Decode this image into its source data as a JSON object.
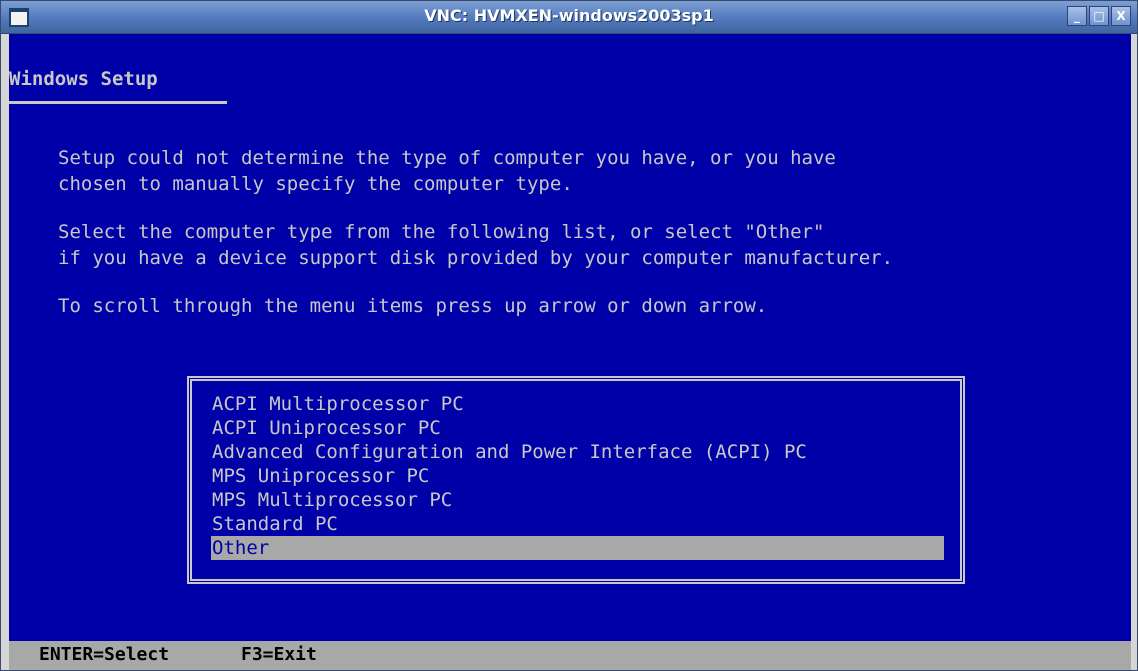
{
  "window": {
    "title": "VNC: HVMXEN-windows2003sp1",
    "buttons": [
      "_",
      "□",
      "X"
    ]
  },
  "setup": {
    "title": "Windows Setup",
    "paragraphs": [
      "Setup could not determine the type of computer you have, or you have\nchosen to manually specify the computer type.",
      "Select the computer type from the following list, or select \"Other\"\nif you have a device support disk provided by your computer manufacturer.",
      "To scroll through the menu items press up arrow or down arrow."
    ],
    "menu": {
      "items": [
        "ACPI Multiprocessor PC",
        "ACPI Uniprocessor PC",
        "Advanced Configuration and Power Interface (ACPI) PC",
        "MPS Uniprocessor PC",
        "MPS Multiprocessor PC",
        "Standard PC",
        "Other"
      ],
      "selected_index": 6
    },
    "status": [
      "ENTER=Select",
      "F3=Exit"
    ]
  },
  "colors": {
    "screen_bg": "#0000a8",
    "text": "#c8c8c8",
    "highlight_bg": "#a8a8a8",
    "status_bg": "#a8a8a8"
  }
}
